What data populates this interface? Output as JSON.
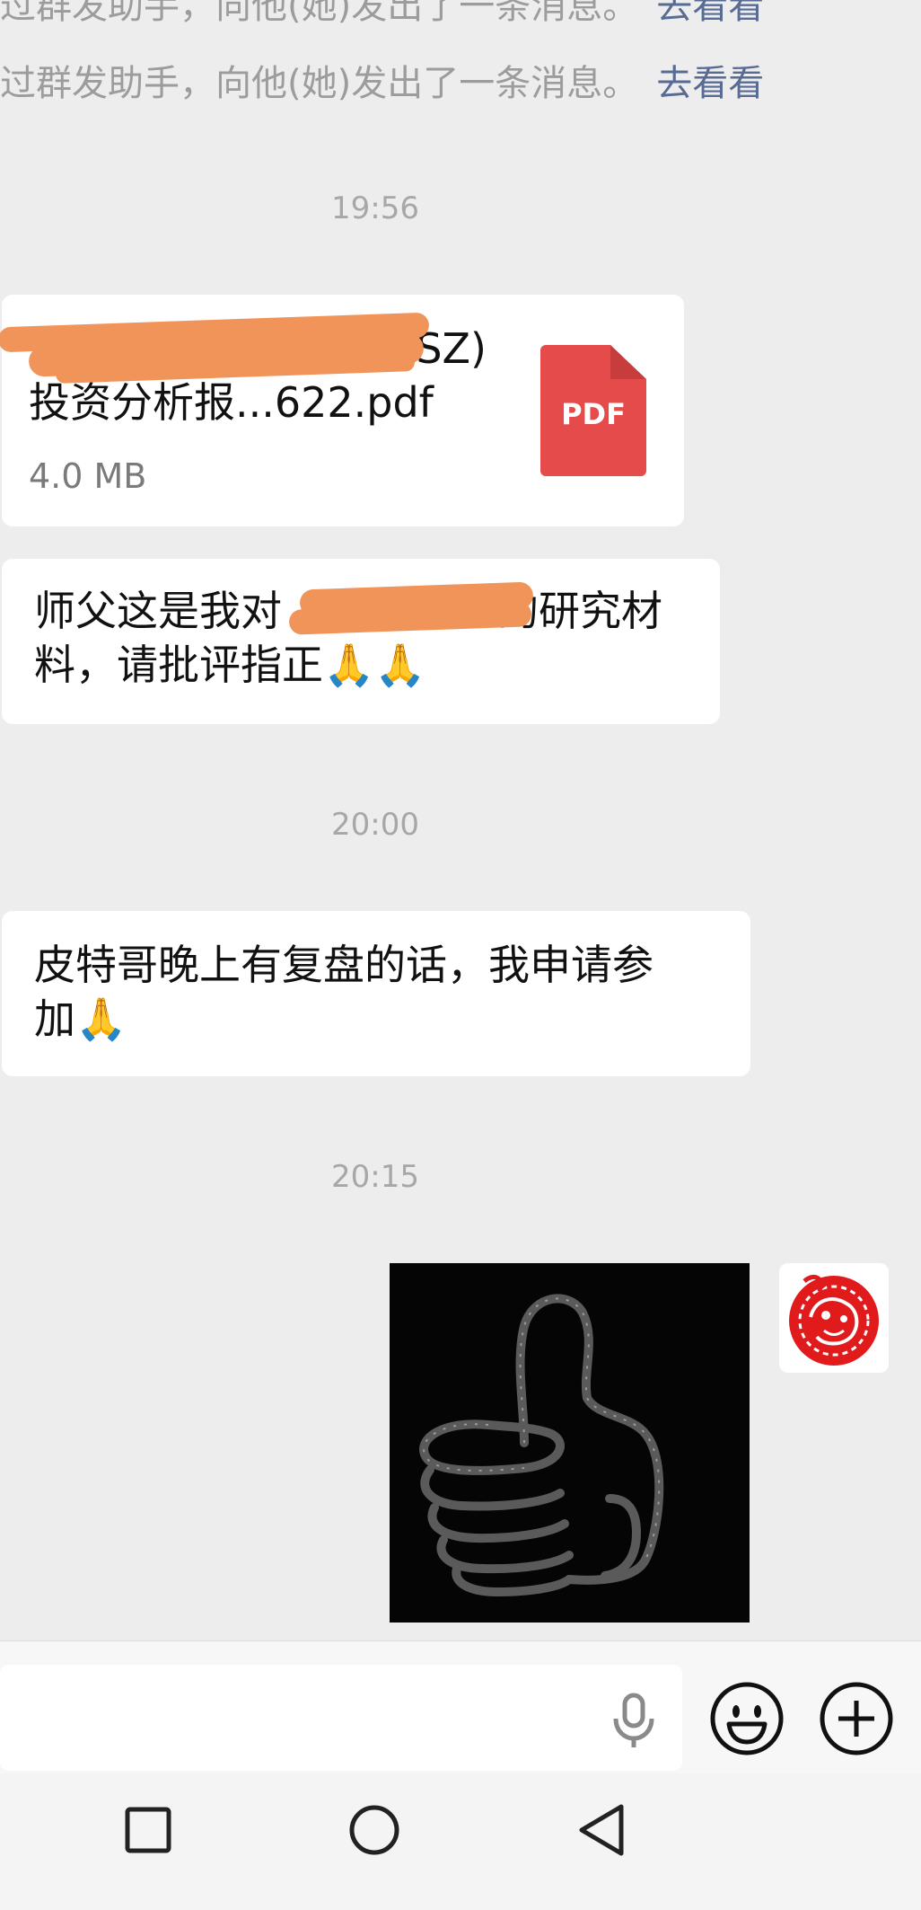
{
  "notices": [
    {
      "text": "过群发助手，向他(她)发出了一条消息。",
      "link": "去看看"
    },
    {
      "text": "过群发助手，向他(她)发出了一条消息。",
      "link": "去看看"
    }
  ],
  "timestamps": [
    "19:56",
    "20:00",
    "20:15"
  ],
  "file_message": {
    "title_line1": "SZ)",
    "title_line2": "投资分析报...622.pdf",
    "size": "4.0 MB",
    "icon_label": "PDF"
  },
  "text_messages": [
    {
      "line1": "师父这是我对",
      "line1_end": "的研究材",
      "line2": "料，请批评指正🙏🙏"
    },
    {
      "line1": "皮特哥晚上有复盘的话，我申请参",
      "line2": "加🙏"
    }
  ],
  "colors": {
    "background": "#ededed",
    "link": "#576b95",
    "redaction": "#f0945a",
    "pdf_icon": "#e64b4b",
    "paper_cut": "#e11b1b"
  },
  "icons": {
    "voice": "microphone-icon",
    "emoji": "smiley-icon",
    "more": "plus-circle-icon",
    "nav_recent": "square-icon",
    "nav_home": "circle-icon",
    "nav_back": "triangle-back-icon"
  }
}
